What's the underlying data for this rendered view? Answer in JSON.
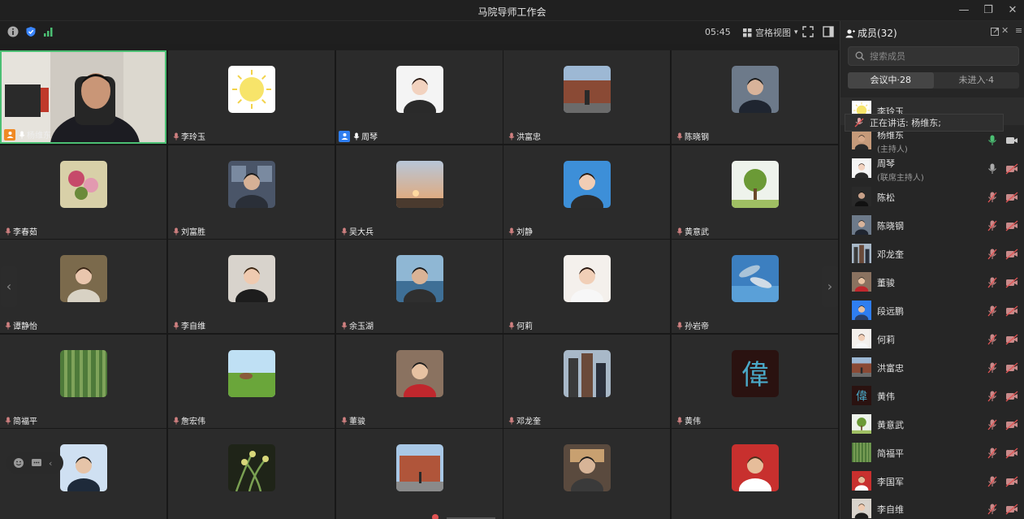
{
  "window": {
    "title": "马院导师工作会"
  },
  "toolbar": {
    "timer": "05:45",
    "view_label": "宫格视图",
    "view_caret": "▾"
  },
  "tiles": [
    {
      "name": "杨维东",
      "video": true,
      "host_badge": true
    },
    {
      "name": "李玲玉",
      "avatar": "sun"
    },
    {
      "name": "周琴",
      "avatar": "woman1",
      "cohost_badge": true
    },
    {
      "name": "洪富忠",
      "avatar": "outdoor1"
    },
    {
      "name": "陈晓钢",
      "avatar": "man_suit"
    },
    {
      "name": "李春茹",
      "avatar": "flowers"
    },
    {
      "name": "刘富胜",
      "avatar": "office"
    },
    {
      "name": "吴大兵",
      "avatar": "sunset"
    },
    {
      "name": "刘静",
      "avatar": "woman2"
    },
    {
      "name": "黄意武",
      "avatar": "tree"
    },
    {
      "name": "谭静怡",
      "avatar": "woman3"
    },
    {
      "name": "李自维",
      "avatar": "woman4"
    },
    {
      "name": "余玉湖",
      "avatar": "lake"
    },
    {
      "name": "何莉",
      "avatar": "woman5"
    },
    {
      "name": "孙岩帝",
      "avatar": "dolphin"
    },
    {
      "name": "简福平",
      "avatar": "bamboo"
    },
    {
      "name": "詹宏伟",
      "avatar": "field"
    },
    {
      "name": "董骏",
      "avatar": "man_glasses"
    },
    {
      "name": "邓龙奎",
      "avatar": "city"
    },
    {
      "name": "黄伟",
      "avatar": "calligraphy",
      "glyph": "偉"
    },
    {
      "name": "",
      "avatar": "man_tie"
    },
    {
      "name": "",
      "avatar": "orchid"
    },
    {
      "name": "",
      "avatar": "building"
    },
    {
      "name": "",
      "avatar": "street"
    },
    {
      "name": "",
      "avatar": "tennis"
    }
  ],
  "panel": {
    "title": "成员(32)",
    "search_placeholder": "搜索成员",
    "tab_in": "会议中·28",
    "tab_out": "未进入·4",
    "tooltip": "正在讲话: 杨维东;",
    "members": [
      {
        "name": "李玲玉",
        "role": "",
        "avatar": "sun",
        "mic": "off",
        "cam": "off"
      },
      {
        "name": "杨维东",
        "role": "(主持人)",
        "avatar": "man_face",
        "mic": "on",
        "cam": "on"
      },
      {
        "name": "周琴",
        "role": "(联席主持人)",
        "avatar": "woman1",
        "mic": "idle",
        "cam": "off"
      },
      {
        "name": "陈松",
        "role": "",
        "avatar": "dark",
        "mic": "off",
        "cam": "off"
      },
      {
        "name": "陈晓钢",
        "role": "",
        "avatar": "man_suit",
        "mic": "off",
        "cam": "off"
      },
      {
        "name": "邓龙奎",
        "role": "",
        "avatar": "city",
        "mic": "off",
        "cam": "off"
      },
      {
        "name": "董骏",
        "role": "",
        "avatar": "man_glasses",
        "mic": "off",
        "cam": "off"
      },
      {
        "name": "段远鹏",
        "role": "",
        "avatar": "blueman",
        "mic": "off",
        "cam": "off"
      },
      {
        "name": "何莉",
        "role": "",
        "avatar": "woman5",
        "mic": "off",
        "cam": "off"
      },
      {
        "name": "洪富忠",
        "role": "",
        "avatar": "outdoor1",
        "mic": "off",
        "cam": "off"
      },
      {
        "name": "黄伟",
        "role": "",
        "avatar": "calligraphy",
        "mic": "off",
        "cam": "off"
      },
      {
        "name": "黄意武",
        "role": "",
        "avatar": "tree",
        "mic": "off",
        "cam": "off"
      },
      {
        "name": "简福平",
        "role": "",
        "avatar": "bamboo",
        "mic": "off",
        "cam": "off"
      },
      {
        "name": "李国军",
        "role": "",
        "avatar": "tennis",
        "mic": "off",
        "cam": "off"
      },
      {
        "name": "李自维",
        "role": "",
        "avatar": "woman4",
        "mic": "off",
        "cam": "off"
      }
    ]
  },
  "colors": {
    "accent_green": "#4bbf73",
    "accent_blue": "#2f7ef0",
    "muted_red": "#e05353",
    "host_orange": "#f08a24"
  }
}
